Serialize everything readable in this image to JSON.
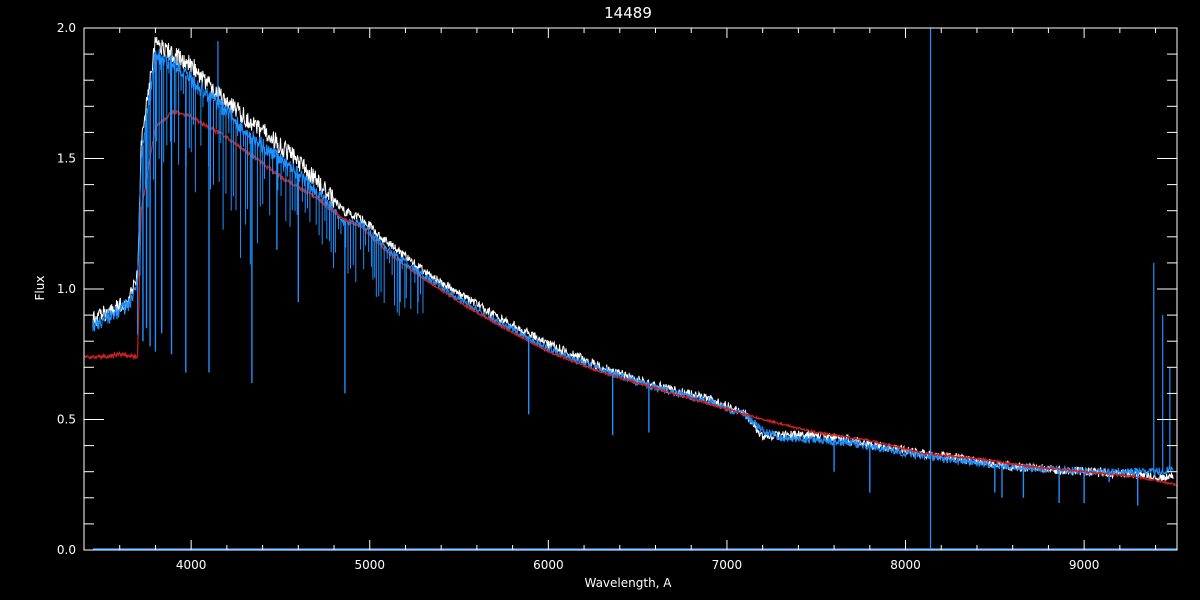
{
  "chart_data": {
    "type": "line",
    "title": "14489",
    "xlabel": "Wavelength, A",
    "ylabel": "Flux",
    "xlim": [
      3400,
      9520
    ],
    "ylim": [
      0,
      2.0
    ],
    "x_ticks": [
      4000,
      5000,
      6000,
      7000,
      8000,
      9000
    ],
    "x_tick_labels": [
      "4000",
      "5000",
      "6000",
      "7000",
      "8000",
      "9000"
    ],
    "y_ticks": [
      0,
      0.5,
      1.0,
      1.5,
      2.0
    ],
    "y_tick_labels": [
      "0.0",
      "0.5",
      "1.0",
      "1.5",
      "2.0"
    ],
    "background": "#000000",
    "axis_color": "#ffffff",
    "series": [
      {
        "key": "observed",
        "color": "#ffffff",
        "x": [
          3450,
          3550,
          3650,
          3700,
          3720,
          3800,
          3900,
          4000,
          4100,
          4200,
          4300,
          4500,
          4700,
          4850,
          4950,
          5100,
          5300,
          5500,
          5700,
          6000,
          6300,
          6600,
          6900,
          7000,
          7100,
          7200,
          7300,
          7500,
          7700,
          8000,
          8300,
          8600,
          9000,
          9300,
          9400,
          9500
        ],
        "y": [
          0.88,
          0.92,
          0.96,
          1.05,
          1.55,
          1.95,
          1.9,
          1.86,
          1.78,
          1.72,
          1.66,
          1.55,
          1.42,
          1.3,
          1.27,
          1.18,
          1.07,
          0.98,
          0.9,
          0.79,
          0.7,
          0.63,
          0.58,
          0.55,
          0.53,
          0.43,
          0.44,
          0.44,
          0.42,
          0.38,
          0.35,
          0.32,
          0.3,
          0.29,
          0.28,
          0.28
        ]
      },
      {
        "key": "observed-blue",
        "color": "#1e90ff",
        "x": [
          3450,
          3550,
          3650,
          3700,
          3720,
          3800,
          3900,
          4000,
          4100,
          4200,
          4300,
          4500,
          4700,
          4850,
          4950,
          5100,
          5300,
          5500,
          5700,
          6000,
          6300,
          6600,
          6900,
          7000,
          7100,
          7200,
          7300,
          7500,
          7700,
          8000,
          8300,
          8600,
          9000,
          9300,
          9400,
          9500
        ],
        "y": [
          0.86,
          0.9,
          0.94,
          1.02,
          1.5,
          1.9,
          1.86,
          1.8,
          1.74,
          1.68,
          1.6,
          1.5,
          1.38,
          1.26,
          1.25,
          1.15,
          1.05,
          0.96,
          0.88,
          0.77,
          0.69,
          0.62,
          0.57,
          0.54,
          0.52,
          0.46,
          0.43,
          0.42,
          0.41,
          0.37,
          0.34,
          0.32,
          0.3,
          0.3,
          0.3,
          0.31
        ]
      },
      {
        "key": "model",
        "color": "#cc2222",
        "x": [
          3400,
          3500,
          3600,
          3700,
          3720,
          3800,
          3900,
          4000,
          4100,
          4200,
          4300,
          4500,
          4700,
          4850,
          4950,
          5100,
          5300,
          5500,
          5700,
          6000,
          6300,
          6600,
          6900,
          7200,
          7500,
          7800,
          8100,
          8400,
          8700,
          9000,
          9300,
          9520
        ],
        "y": [
          0.74,
          0.74,
          0.75,
          0.74,
          1.3,
          1.62,
          1.68,
          1.66,
          1.62,
          1.58,
          1.53,
          1.43,
          1.35,
          1.27,
          1.24,
          1.14,
          1.04,
          0.95,
          0.87,
          0.76,
          0.68,
          0.62,
          0.56,
          0.5,
          0.45,
          0.42,
          0.37,
          0.35,
          0.32,
          0.3,
          0.28,
          0.25
        ]
      }
    ],
    "absorption_lines": [
      {
        "x": 3730,
        "y": 0.8
      },
      {
        "x": 3750,
        "y": 0.85
      },
      {
        "x": 3770,
        "y": 0.78
      },
      {
        "x": 3800,
        "y": 0.76
      },
      {
        "x": 3835,
        "y": 0.83
      },
      {
        "x": 3890,
        "y": 0.75
      },
      {
        "x": 3970,
        "y": 0.68
      },
      {
        "x": 4100,
        "y": 0.68
      },
      {
        "x": 4340,
        "y": 0.64
      },
      {
        "x": 4480,
        "y": 1.15
      },
      {
        "x": 4600,
        "y": 0.95
      },
      {
        "x": 4861,
        "y": 0.6
      },
      {
        "x": 5170,
        "y": 0.95
      },
      {
        "x": 5270,
        "y": 0.95
      },
      {
        "x": 5890,
        "y": 0.52
      },
      {
        "x": 6360,
        "y": 0.44
      },
      {
        "x": 6563,
        "y": 0.45
      },
      {
        "x": 7600,
        "y": 0.3
      },
      {
        "x": 7800,
        "y": 0.22
      },
      {
        "x": 8500,
        "y": 0.22
      },
      {
        "x": 8540,
        "y": 0.2
      },
      {
        "x": 8660,
        "y": 0.2
      },
      {
        "x": 8860,
        "y": 0.18
      },
      {
        "x": 9000,
        "y": 0.18
      },
      {
        "x": 9300,
        "y": 0.17
      },
      {
        "x": 9140,
        "y": 0.26
      }
    ],
    "spikes": [
      {
        "x": 4150,
        "y": 1.95
      },
      {
        "x": 8140,
        "y": 2.0
      },
      {
        "x": 9390,
        "y": 1.1
      },
      {
        "x": 9440,
        "y": 0.9
      },
      {
        "x": 9480,
        "y": 0.7
      }
    ],
    "baseline": {
      "color": "#1e90ff",
      "y": 0.0
    }
  }
}
